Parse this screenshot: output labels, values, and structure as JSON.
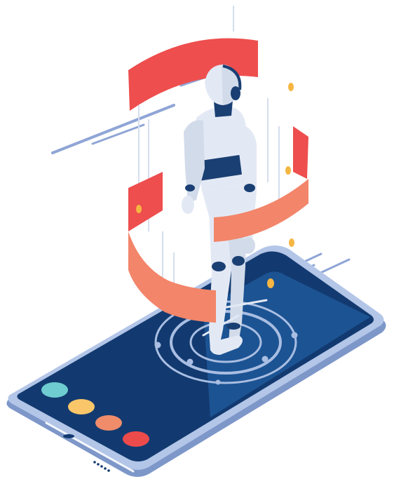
{
  "illustration": {
    "subject": "isometric-robot-on-smartphone",
    "colors": {
      "phone_frame": "#B3C6E8",
      "phone_frame_shadow": "#7E97C9",
      "screen_dark": "#123A70",
      "screen_light": "#1E5697",
      "ring_red": "#EE4E4E",
      "ring_salmon": "#F2856A",
      "robot_body": "#E3E9F4",
      "robot_shade": "#BCC8DD",
      "robot_dark": "#1A3F73",
      "accent_gold": "#F5B642",
      "line_blue": "#8FA5D6",
      "scan_ring": "#A9BEE2"
    },
    "dots": [
      {
        "name": "teal-dot",
        "color": "#6FCCD0"
      },
      {
        "name": "yellow-dot",
        "color": "#F9C66A"
      },
      {
        "name": "orange-dot",
        "color": "#F08C6A"
      },
      {
        "name": "red-dot",
        "color": "#EC4B4B"
      }
    ],
    "icons": [
      "phone-speaker-icon",
      "phone-camera-icon",
      "scan-target-icon",
      "headset-icon"
    ]
  }
}
